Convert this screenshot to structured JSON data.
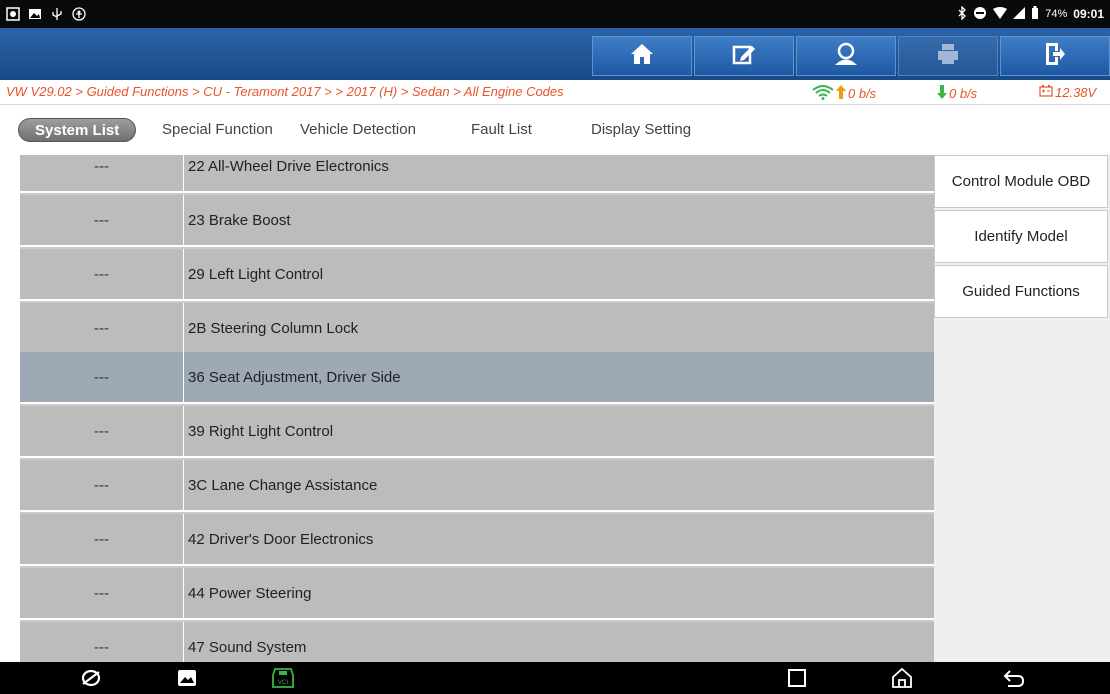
{
  "status_bar": {
    "battery_percent": "74%",
    "time": "09:01"
  },
  "breadcrumb": "VW V29.02 > Guided Functions > CU - Teramont 2017 > > 2017 (H) > Sedan > All Engine Codes",
  "network": {
    "up": "0 b/s",
    "down": "0 b/s",
    "voltage": "12.38V"
  },
  "tabs": [
    "System List",
    "Special Function",
    "Vehicle Detection",
    "Fault List",
    "Display Setting"
  ],
  "rows": [
    {
      "status": "---",
      "name": "22 All-Wheel Drive Electronics"
    },
    {
      "status": "---",
      "name": "23 Brake Boost"
    },
    {
      "status": "---",
      "name": "29 Left Light Control"
    },
    {
      "status": "---",
      "name": "2B Steering Column Lock"
    },
    {
      "status": "---",
      "name": "36 Seat Adjustment, Driver Side"
    },
    {
      "status": "---",
      "name": "39 Right Light Control"
    },
    {
      "status": "---",
      "name": "3C Lane Change Assistance"
    },
    {
      "status": "---",
      "name": "42 Driver's Door Electronics"
    },
    {
      "status": "---",
      "name": "44 Power Steering"
    },
    {
      "status": "---",
      "name": "47 Sound System"
    }
  ],
  "side_buttons": [
    "Control Module OBD",
    "Identify Model",
    "Guided Functions"
  ],
  "colors": {
    "toolbar": "#1f5597",
    "breadcrumb_text": "#e8532a",
    "selected_row": "#9ea9b6",
    "row": "#bcbcbc"
  },
  "icons": [
    "home-icon",
    "edit-report-icon",
    "user-support-icon",
    "print-icon",
    "exit-icon"
  ]
}
